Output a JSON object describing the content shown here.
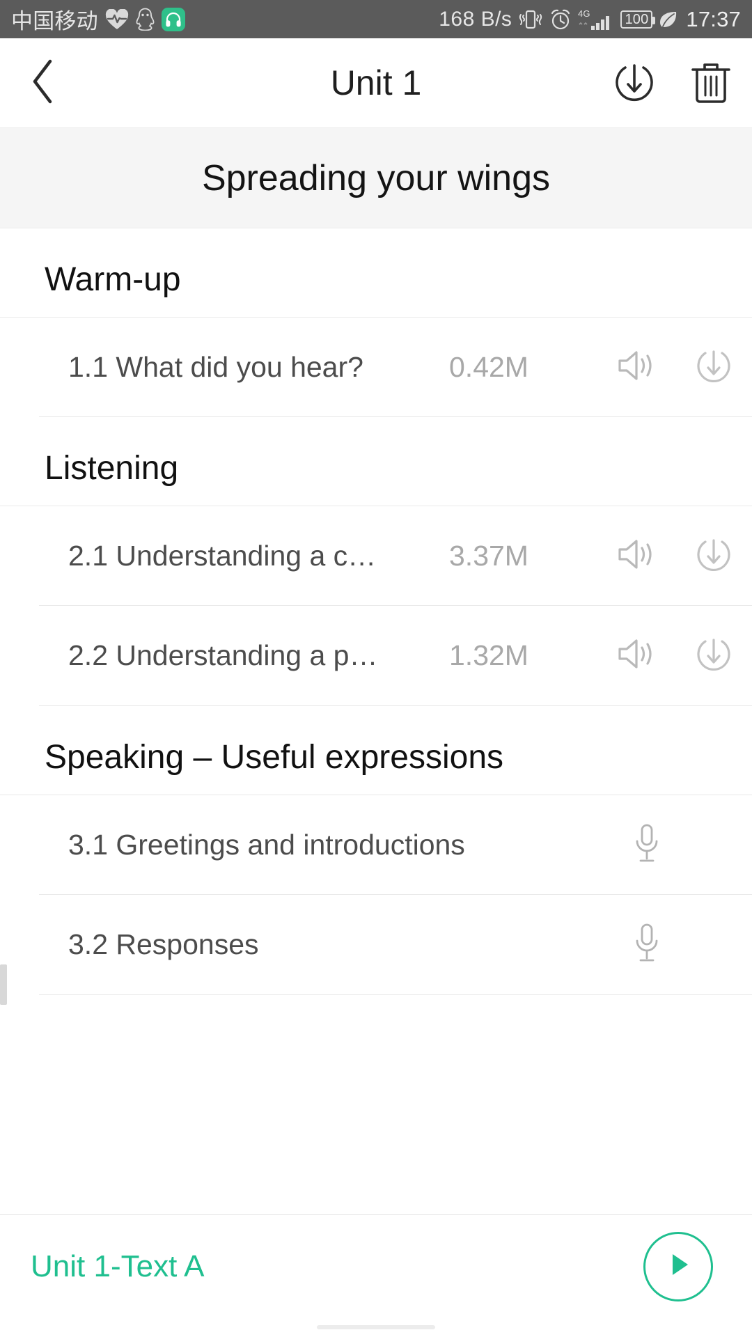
{
  "status_bar": {
    "carrier": "中国移动",
    "net_speed": "168 B/s",
    "battery_level": "100",
    "time": "17:37",
    "icons": [
      "heart-rate-icon",
      "qq-penguin-icon",
      "headphones-badge-icon",
      "vibrate-icon",
      "alarm-clock-icon",
      "signal-4g-icon",
      "battery-icon",
      "leaf-power-saving-icon"
    ],
    "network_type": "4G"
  },
  "nav_bar": {
    "back_icon": "chevron-left-icon",
    "title": "Unit 1",
    "download_icon": "download-circle-icon",
    "delete_icon": "trash-icon"
  },
  "banner": {
    "title": "Spreading your wings"
  },
  "sections": [
    {
      "heading": "Warm-up",
      "items": [
        {
          "title": "1.1 What did you hear?",
          "size": "0.42M",
          "type": "audio"
        }
      ]
    },
    {
      "heading": "Listening",
      "items": [
        {
          "title": "2.1 Understanding a c…",
          "size": "3.37M",
          "type": "audio"
        },
        {
          "title": "2.2 Understanding a p…",
          "size": "1.32M",
          "type": "audio"
        }
      ]
    },
    {
      "heading": "Speaking – Useful expressions",
      "items": [
        {
          "title": "3.1 Greetings and introductions",
          "size": "",
          "type": "record"
        },
        {
          "title": "3.2 Responses",
          "size": "",
          "type": "record"
        }
      ]
    }
  ],
  "player": {
    "now_playing": "Unit 1-Text A",
    "play_icon": "play-icon"
  },
  "colors": {
    "accent": "#1fbf8f",
    "status_bar_bg": "#5b5b5b",
    "banner_bg": "#f5f5f5",
    "title_text": "#1f1f1f",
    "item_text": "#4c4c4c",
    "size_text": "#a8a8a8"
  }
}
